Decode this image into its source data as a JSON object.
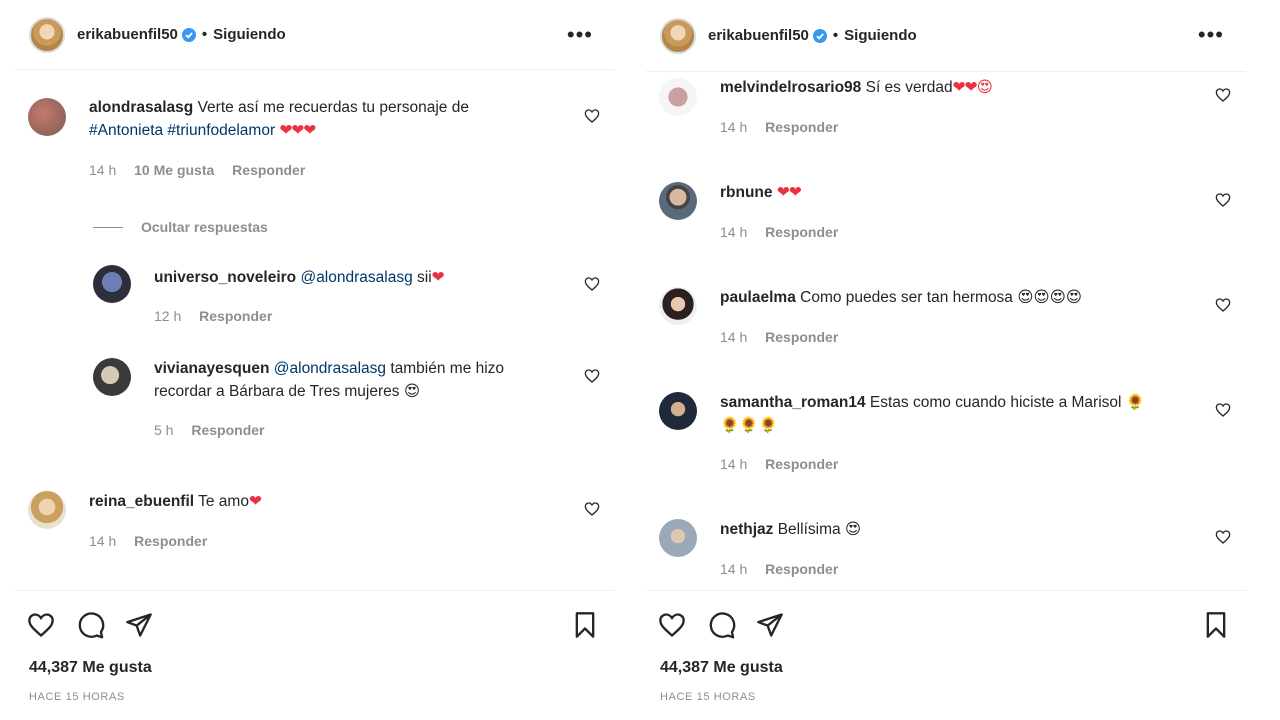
{
  "left": {
    "header": {
      "username": "erikabuenfil50",
      "follow_status": "Siguiendo",
      "separator": "•"
    },
    "hide_replies": "Ocultar respuestas",
    "comments": [
      {
        "user": "alondrasalasg",
        "text": "Verte así me recuerdas tu personaje de",
        "tags": "#Antonieta #triunfodelamor",
        "emoji": "❤❤❤",
        "time": "14 h",
        "likes": "10 Me gusta",
        "reply": "Responder"
      },
      {
        "user": "universo_noveleiro",
        "mention": "@alondrasalasg",
        "text": "sii",
        "emoji": "❤",
        "time": "12 h",
        "reply": "Responder"
      },
      {
        "user": "vivianayesquen",
        "mention": "@alondrasalasg",
        "text": "también me hizo",
        "text2": "recordar a Bárbara de Tres mujeres",
        "emoji": "😍",
        "time": "5 h",
        "reply": "Responder"
      },
      {
        "user": "reina_ebuenfil",
        "text": "Te amo",
        "emoji": "❤",
        "time": "14 h",
        "reply": "Responder"
      }
    ],
    "likes_count": "44,387 Me gusta",
    "posted": "HACE 15 HORAS"
  },
  "right": {
    "header": {
      "username": "erikabuenfil50",
      "follow_status": "Siguiendo",
      "separator": "•"
    },
    "comments": [
      {
        "user": "melvindelrosario98",
        "text": "Sí es verdad",
        "emoji": "❤❤😍",
        "time": "14 h",
        "reply": "Responder"
      },
      {
        "user": "rbnune",
        "text": "",
        "emoji": "❤❤",
        "time": "14 h",
        "reply": "Responder"
      },
      {
        "user": "paulaelma",
        "text": "Como puedes ser tan hermosa",
        "emoji": "😍😍😍😍",
        "time": "14 h",
        "reply": "Responder"
      },
      {
        "user": "samantha_roman14",
        "text": "Estas como cuando hiciste a Marisol",
        "emoji": "🌻",
        "emoji2": "🌻🌻🌻",
        "time": "14 h",
        "reply": "Responder"
      },
      {
        "user": "nethjaz",
        "text": "Bellísima",
        "emoji": "😍",
        "time": "14 h",
        "reply": "Responder"
      }
    ],
    "likes_count": "44,387 Me gusta",
    "posted": "HACE 15 HORAS"
  },
  "icons": {
    "verified": "verified-badge-icon",
    "more": "more-options-icon",
    "heart": "heart-icon",
    "comment": "comment-icon",
    "share": "share-icon",
    "save": "bookmark-icon"
  },
  "colors": {
    "verified": "#3897f0",
    "link": "#00376b",
    "muted": "#8e8e8e",
    "heart_emoji": "#ed2f3f"
  }
}
